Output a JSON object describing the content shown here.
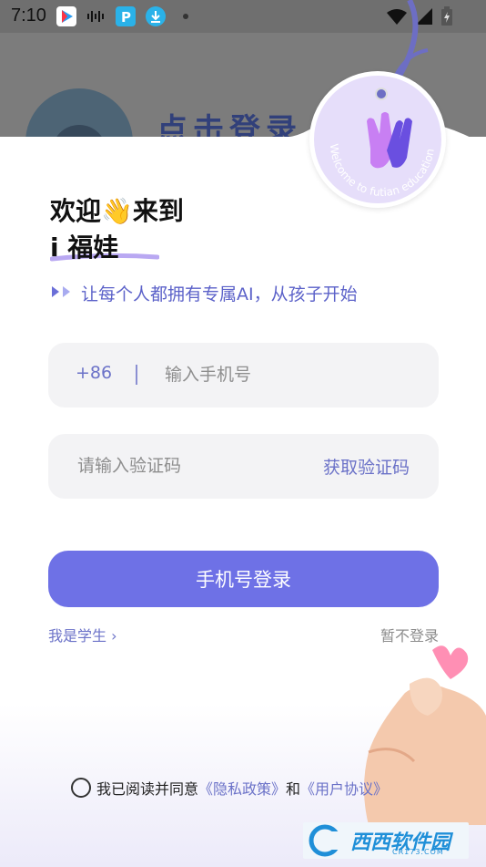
{
  "status_bar": {
    "time": "7:10"
  },
  "background": {
    "partial_title": "点击登录"
  },
  "tag": {
    "text": "Welcome to futian education"
  },
  "header": {
    "welcome_line1": "欢迎👋来到",
    "welcome_line2": "i 福娃",
    "slogan": "让每个人都拥有专属AI，从孩子开始"
  },
  "form": {
    "country_code": "+86",
    "phone_placeholder": "输入手机号",
    "code_placeholder": "请输入验证码",
    "get_code_label": "获取验证码",
    "login_label": "手机号登录"
  },
  "links": {
    "student": "我是学生 ›",
    "skip": "暂不登录"
  },
  "agreement": {
    "prefix": "我已阅读并同意",
    "privacy": "《隐私政策》",
    "and": "和",
    "terms": "《用户协议》"
  },
  "watermark": {
    "brand": "西西软件园",
    "url": "CR173.COM"
  },
  "colors": {
    "accent": "#6e71e6",
    "link": "#6b72c8",
    "tag_bg": "#e6defa"
  }
}
